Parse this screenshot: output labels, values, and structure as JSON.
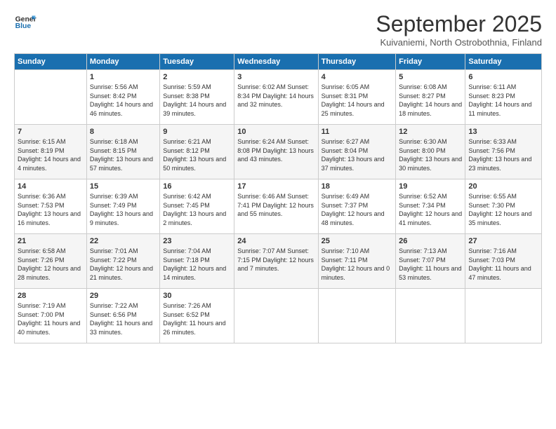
{
  "logo": {
    "line1": "General",
    "line2": "Blue"
  },
  "title": "September 2025",
  "subtitle": "Kuivaniemi, North Ostrobothnia, Finland",
  "header_days": [
    "Sunday",
    "Monday",
    "Tuesday",
    "Wednesday",
    "Thursday",
    "Friday",
    "Saturday"
  ],
  "weeks": [
    [
      {
        "day": "",
        "info": ""
      },
      {
        "day": "1",
        "info": "Sunrise: 5:56 AM\nSunset: 8:42 PM\nDaylight: 14 hours\nand 46 minutes."
      },
      {
        "day": "2",
        "info": "Sunrise: 5:59 AM\nSunset: 8:38 PM\nDaylight: 14 hours\nand 39 minutes."
      },
      {
        "day": "3",
        "info": "Sunrise: 6:02 AM\nSunset: 8:34 PM\nDaylight: 14 hours\nand 32 minutes."
      },
      {
        "day": "4",
        "info": "Sunrise: 6:05 AM\nSunset: 8:31 PM\nDaylight: 14 hours\nand 25 minutes."
      },
      {
        "day": "5",
        "info": "Sunrise: 6:08 AM\nSunset: 8:27 PM\nDaylight: 14 hours\nand 18 minutes."
      },
      {
        "day": "6",
        "info": "Sunrise: 6:11 AM\nSunset: 8:23 PM\nDaylight: 14 hours\nand 11 minutes."
      }
    ],
    [
      {
        "day": "7",
        "info": "Sunrise: 6:15 AM\nSunset: 8:19 PM\nDaylight: 14 hours\nand 4 minutes."
      },
      {
        "day": "8",
        "info": "Sunrise: 6:18 AM\nSunset: 8:15 PM\nDaylight: 13 hours\nand 57 minutes."
      },
      {
        "day": "9",
        "info": "Sunrise: 6:21 AM\nSunset: 8:12 PM\nDaylight: 13 hours\nand 50 minutes."
      },
      {
        "day": "10",
        "info": "Sunrise: 6:24 AM\nSunset: 8:08 PM\nDaylight: 13 hours\nand 43 minutes."
      },
      {
        "day": "11",
        "info": "Sunrise: 6:27 AM\nSunset: 8:04 PM\nDaylight: 13 hours\nand 37 minutes."
      },
      {
        "day": "12",
        "info": "Sunrise: 6:30 AM\nSunset: 8:00 PM\nDaylight: 13 hours\nand 30 minutes."
      },
      {
        "day": "13",
        "info": "Sunrise: 6:33 AM\nSunset: 7:56 PM\nDaylight: 13 hours\nand 23 minutes."
      }
    ],
    [
      {
        "day": "14",
        "info": "Sunrise: 6:36 AM\nSunset: 7:53 PM\nDaylight: 13 hours\nand 16 minutes."
      },
      {
        "day": "15",
        "info": "Sunrise: 6:39 AM\nSunset: 7:49 PM\nDaylight: 13 hours\nand 9 minutes."
      },
      {
        "day": "16",
        "info": "Sunrise: 6:42 AM\nSunset: 7:45 PM\nDaylight: 13 hours\nand 2 minutes."
      },
      {
        "day": "17",
        "info": "Sunrise: 6:46 AM\nSunset: 7:41 PM\nDaylight: 12 hours\nand 55 minutes."
      },
      {
        "day": "18",
        "info": "Sunrise: 6:49 AM\nSunset: 7:37 PM\nDaylight: 12 hours\nand 48 minutes."
      },
      {
        "day": "19",
        "info": "Sunrise: 6:52 AM\nSunset: 7:34 PM\nDaylight: 12 hours\nand 41 minutes."
      },
      {
        "day": "20",
        "info": "Sunrise: 6:55 AM\nSunset: 7:30 PM\nDaylight: 12 hours\nand 35 minutes."
      }
    ],
    [
      {
        "day": "21",
        "info": "Sunrise: 6:58 AM\nSunset: 7:26 PM\nDaylight: 12 hours\nand 28 minutes."
      },
      {
        "day": "22",
        "info": "Sunrise: 7:01 AM\nSunset: 7:22 PM\nDaylight: 12 hours\nand 21 minutes."
      },
      {
        "day": "23",
        "info": "Sunrise: 7:04 AM\nSunset: 7:18 PM\nDaylight: 12 hours\nand 14 minutes."
      },
      {
        "day": "24",
        "info": "Sunrise: 7:07 AM\nSunset: 7:15 PM\nDaylight: 12 hours\nand 7 minutes."
      },
      {
        "day": "25",
        "info": "Sunrise: 7:10 AM\nSunset: 7:11 PM\nDaylight: 12 hours\nand 0 minutes."
      },
      {
        "day": "26",
        "info": "Sunrise: 7:13 AM\nSunset: 7:07 PM\nDaylight: 11 hours\nand 53 minutes."
      },
      {
        "day": "27",
        "info": "Sunrise: 7:16 AM\nSunset: 7:03 PM\nDaylight: 11 hours\nand 47 minutes."
      }
    ],
    [
      {
        "day": "28",
        "info": "Sunrise: 7:19 AM\nSunset: 7:00 PM\nDaylight: 11 hours\nand 40 minutes."
      },
      {
        "day": "29",
        "info": "Sunrise: 7:22 AM\nSunset: 6:56 PM\nDaylight: 11 hours\nand 33 minutes."
      },
      {
        "day": "30",
        "info": "Sunrise: 7:26 AM\nSunset: 6:52 PM\nDaylight: 11 hours\nand 26 minutes."
      },
      {
        "day": "",
        "info": ""
      },
      {
        "day": "",
        "info": ""
      },
      {
        "day": "",
        "info": ""
      },
      {
        "day": "",
        "info": ""
      }
    ]
  ]
}
